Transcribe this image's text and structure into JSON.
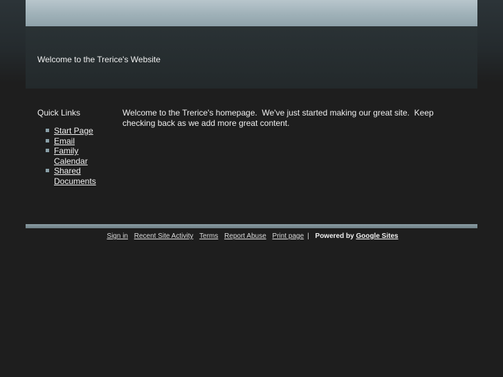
{
  "header": {
    "site_title": "Welcome to the Trerice's Website"
  },
  "sidebar": {
    "title": "Quick Links",
    "links": [
      {
        "label": "Start Page"
      },
      {
        "label": "Email"
      },
      {
        "label": "Family Calendar"
      },
      {
        "label": "Shared Documents"
      }
    ]
  },
  "main": {
    "body_text": "Welcome to the Trerice's homepage.  We've just started making our great site.  Keep checking back as we add more great content."
  },
  "footer": {
    "links": [
      {
        "label": "Sign in"
      },
      {
        "label": "Recent Site Activity"
      },
      {
        "label": "Terms"
      },
      {
        "label": "Report Abuse"
      },
      {
        "label": "Print page"
      }
    ],
    "separator": "|",
    "powered_prefix": "Powered by",
    "powered_link": "Google Sites"
  },
  "colors": {
    "background": "#1e1e1e",
    "top_bar": "#9fb1b8",
    "accent_bar": "#7d8f96",
    "bullet": "#8aa0a8"
  }
}
